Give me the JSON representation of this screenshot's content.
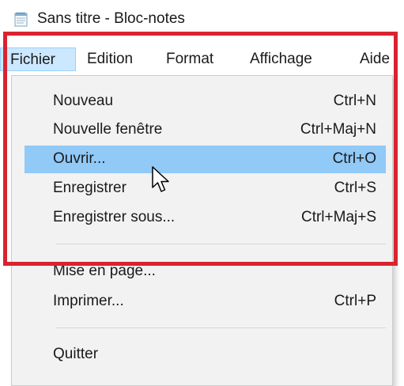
{
  "window": {
    "title": "Sans titre - Bloc-notes",
    "icon": "notepad-icon"
  },
  "menubar": {
    "items": [
      {
        "label": "Fichier",
        "active": true
      },
      {
        "label": "Edition"
      },
      {
        "label": "Format"
      },
      {
        "label": "Affichage"
      },
      {
        "label": "Aide"
      }
    ]
  },
  "file_menu": {
    "items": [
      {
        "label": "Nouveau",
        "shortcut": "Ctrl+N"
      },
      {
        "label": "Nouvelle fenêtre",
        "shortcut": "Ctrl+Maj+N"
      },
      {
        "label": "Ouvrir...",
        "shortcut": "Ctrl+O",
        "highlighted": true
      },
      {
        "label": "Enregistrer",
        "shortcut": "Ctrl+S"
      },
      {
        "label": "Enregistrer sous...",
        "shortcut": "Ctrl+Maj+S"
      },
      {
        "label": "Mise en page...",
        "shortcut": ""
      },
      {
        "label": "Imprimer...",
        "shortcut": "Ctrl+P"
      },
      {
        "label": "Quitter",
        "shortcut": ""
      }
    ]
  },
  "colors": {
    "highlight_frame": "#d9232f",
    "menu_hover": "#91c9f7",
    "menu_active": "#cce8ff"
  }
}
